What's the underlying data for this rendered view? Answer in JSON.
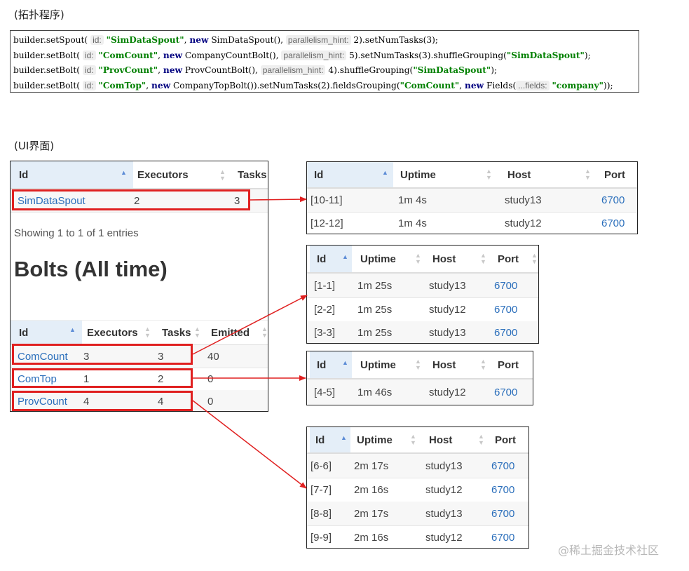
{
  "captions": {
    "topology": "(拓扑程序)",
    "ui": "(UI界面)"
  },
  "code": {
    "line1": {
      "a": "builder.setSpout(",
      "h1": "id:",
      "s1": "\"SimDataSpout\"",
      "b": ",",
      "kw": "new",
      "c": "SimDataSpout(),",
      "h2": "parallelism_hint:",
      "d": "2).setNumTasks(3);"
    },
    "line2": {
      "a": "builder.setBolt(",
      "h1": "id:",
      "s1": "\"ComCount\"",
      "b": ",",
      "kw": "new",
      "c": "CompanyCountBolt(),",
      "h2": "parallelism_hint:",
      "d": "5).setNumTasks(3).shuffleGrouping(",
      "s2": "\"SimDataSpout\"",
      "e": ");"
    },
    "line3": {
      "a": "builder.setBolt(",
      "h1": "id:",
      "s1": "\"ProvCount\"",
      "b": ",",
      "kw": "new",
      "c": "ProvCountBolt(),",
      "h2": "parallelism_hint:",
      "d": "4).shuffleGrouping(",
      "s2": "\"SimDataSpout\"",
      "e": ");"
    },
    "line4": {
      "a": "builder.setBolt(",
      "h1": "id:",
      "s1": "\"ComTop\"",
      "b": ",",
      "kw": "new",
      "c": "CompanyTopBolt()).setNumTasks(2).fieldsGrouping(",
      "s2": "\"ComCount\"",
      "b2": ",",
      "kw2": "new",
      "d": "Fields(",
      "h2": "...fields:",
      "s3": "\"company\"",
      "e": "));"
    }
  },
  "spouts": {
    "headers": [
      "Id",
      "Executors",
      "Tasks"
    ],
    "rows": [
      {
        "id": "SimDataSpout",
        "executors": "2",
        "tasks": "3"
      }
    ],
    "showing": "Showing 1 to 1 of 1 entries"
  },
  "bolts": {
    "title": "Bolts (All time)",
    "headers": [
      "Id",
      "Executors",
      "Tasks",
      "Emitted"
    ],
    "rows": [
      {
        "id": "ComCount",
        "executors": "3",
        "tasks": "3",
        "emitted": "40"
      },
      {
        "id": "ComTop",
        "executors": "1",
        "tasks": "2",
        "emitted": "0"
      },
      {
        "id": "ProvCount",
        "executors": "4",
        "tasks": "4",
        "emitted": "0"
      }
    ]
  },
  "executor_tables": {
    "headers": [
      "Id",
      "Uptime",
      "Host",
      "Port"
    ],
    "spout": [
      {
        "id": "[10-11]",
        "uptime": "1m 4s",
        "host": "study13",
        "port": "6700"
      },
      {
        "id": "[12-12]",
        "uptime": "1m 4s",
        "host": "study12",
        "port": "6700"
      }
    ],
    "comcount": [
      {
        "id": "[1-1]",
        "uptime": "1m 25s",
        "host": "study13",
        "port": "6700"
      },
      {
        "id": "[2-2]",
        "uptime": "1m 25s",
        "host": "study12",
        "port": "6700"
      },
      {
        "id": "[3-3]",
        "uptime": "1m 25s",
        "host": "study13",
        "port": "6700"
      }
    ],
    "comtop": [
      {
        "id": "[4-5]",
        "uptime": "1m 46s",
        "host": "study12",
        "port": "6700"
      }
    ],
    "provcount": [
      {
        "id": "[6-6]",
        "uptime": "2m 17s",
        "host": "study13",
        "port": "6700"
      },
      {
        "id": "[7-7]",
        "uptime": "2m 16s",
        "host": "study12",
        "port": "6700"
      },
      {
        "id": "[8-8]",
        "uptime": "2m 17s",
        "host": "study13",
        "port": "6700"
      },
      {
        "id": "[9-9]",
        "uptime": "2m 16s",
        "host": "study12",
        "port": "6700"
      }
    ]
  },
  "watermark": "@稀土掘金技术社区",
  "colors": {
    "link": "#2a6ebb",
    "highlight": "#e02020",
    "sort_active": "#5b8bd6"
  }
}
